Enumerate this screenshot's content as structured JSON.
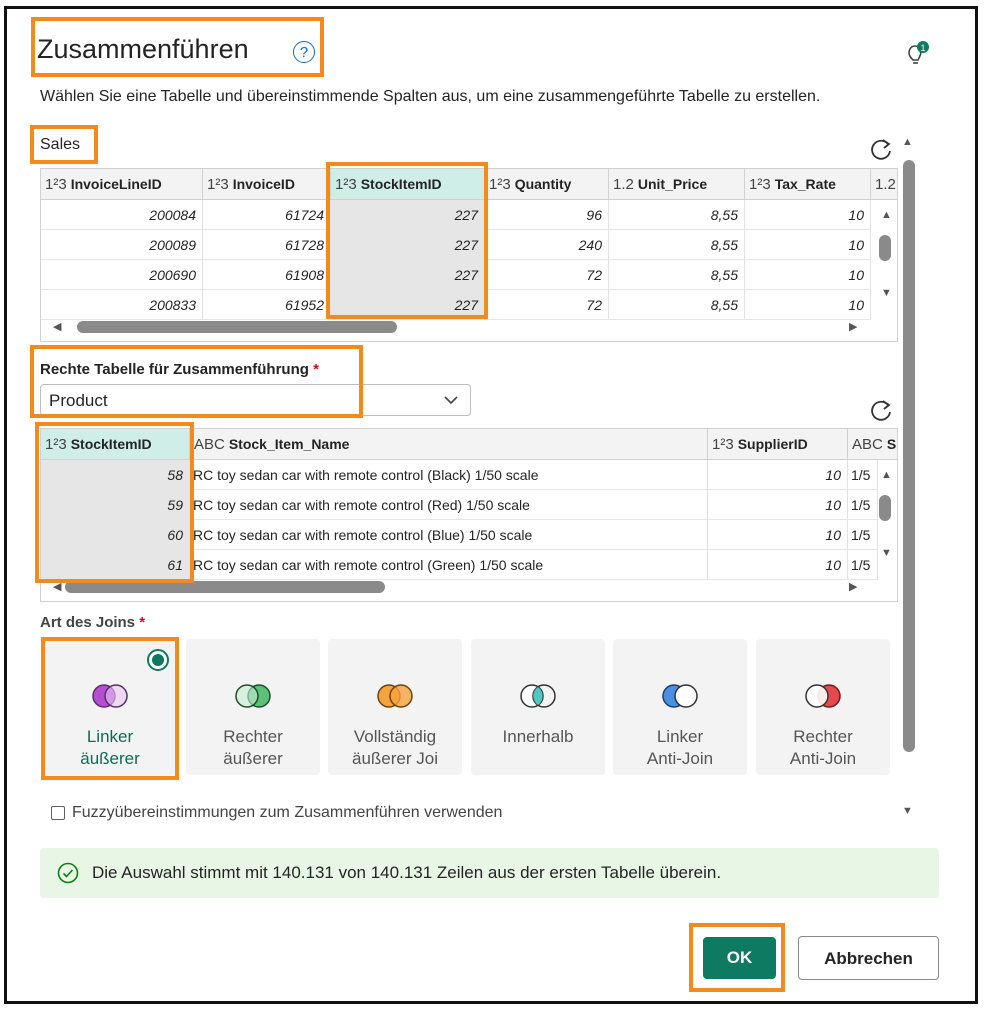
{
  "dialog": {
    "title": "Zusammenführen",
    "help_glyph": "?",
    "lightbulb_badge": "1",
    "subtitle": "Wählen Sie eine Tabelle und übereinstimmende Spalten aus, um eine zusammengeführte Tabelle zu erstellen."
  },
  "left_table": {
    "name": "Sales",
    "columns": [
      {
        "type": "1²3",
        "name": "InvoiceLineID"
      },
      {
        "type": "1²3",
        "name": "InvoiceID"
      },
      {
        "type": "1²3",
        "name": "StockItemID"
      },
      {
        "type": "1²3",
        "name": "Quantity"
      },
      {
        "type": "1.2",
        "name": "Unit_Price"
      },
      {
        "type": "1²3",
        "name": "Tax_Rate"
      },
      {
        "type": "1.2",
        "name": ""
      }
    ],
    "rows": [
      [
        "200084",
        "61724",
        "227",
        "96",
        "8,55",
        "10"
      ],
      [
        "200089",
        "61728",
        "227",
        "240",
        "8,55",
        "10"
      ],
      [
        "200690",
        "61908",
        "227",
        "72",
        "8,55",
        "10"
      ],
      [
        "200833",
        "61952",
        "227",
        "72",
        "8,55",
        "10"
      ]
    ]
  },
  "right_table": {
    "label": "Rechte Tabelle für Zusammenführung",
    "required_mark": "*",
    "selected": "Product",
    "columns": [
      {
        "type": "1²3",
        "name": "StockItemID"
      },
      {
        "type": "ABC",
        "name": "Stock_Item_Name"
      },
      {
        "type": "1²3",
        "name": "SupplierID"
      },
      {
        "type": "ABC",
        "name": "Siz"
      }
    ],
    "rows": [
      [
        "58",
        "RC toy sedan car with remote control (Black) 1/50 scale",
        "10",
        "1/5"
      ],
      [
        "59",
        "RC toy sedan car with remote control (Red) 1/50 scale",
        "10",
        "1/5"
      ],
      [
        "60",
        "RC toy sedan car with remote control (Blue) 1/50 scale",
        "10",
        "1/5"
      ],
      [
        "61",
        "RC toy sedan car with remote control (Green) 1/50 scale",
        "10",
        "1/5"
      ]
    ]
  },
  "join": {
    "label": "Art des Joins",
    "required_mark": "*",
    "options": [
      {
        "line1": "Linker",
        "line2": "äußerer",
        "selected": true
      },
      {
        "line1": "Rechter",
        "line2": "äußerer",
        "selected": false
      },
      {
        "line1": "Vollständig",
        "line2": "äußerer Joi",
        "selected": false
      },
      {
        "line1": "Innerhalb",
        "line2": "",
        "selected": false
      },
      {
        "line1": "Linker",
        "line2": "Anti-Join",
        "selected": false
      },
      {
        "line1": "Rechter",
        "line2": "Anti-Join",
        "selected": false
      }
    ]
  },
  "fuzzy": {
    "label": "Fuzzyübereinstimmungen zum Zusammenführen verwenden",
    "checked": false
  },
  "status": {
    "text": "Die Auswahl stimmt mit 140.131 von 140.131 Zeilen aus der ersten Tabelle überein."
  },
  "buttons": {
    "ok": "OK",
    "cancel": "Abbrechen"
  },
  "colors": {
    "accent": "#0e7a62",
    "highlight": "#f28a1e",
    "success_bg": "#e8f6e6"
  }
}
